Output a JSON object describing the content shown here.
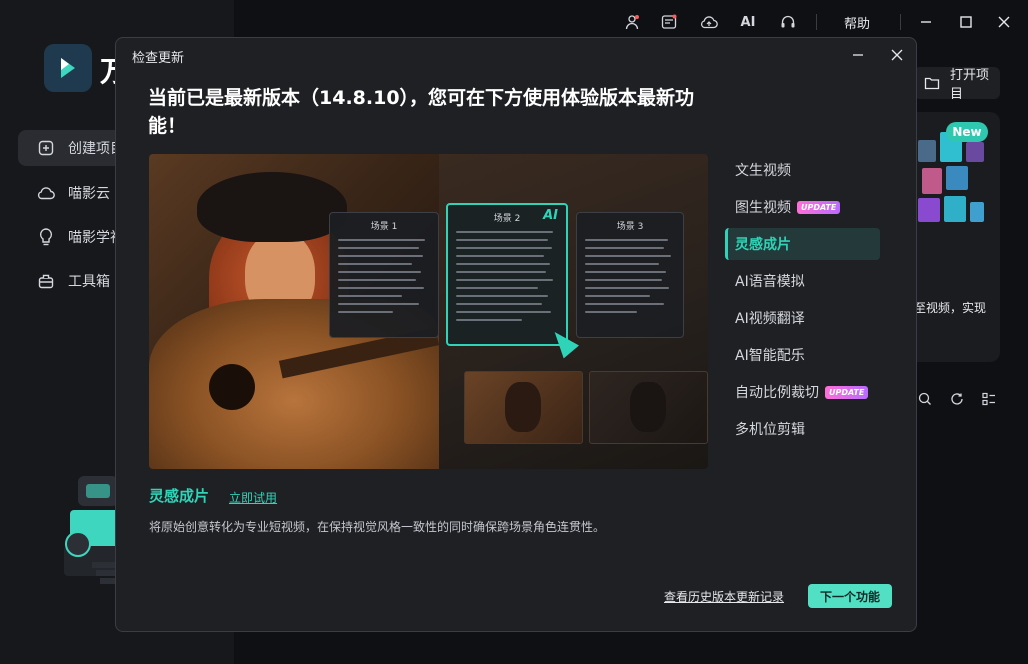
{
  "app": {
    "logo_text": "万",
    "nav": [
      {
        "label": "创建项目"
      },
      {
        "label": "喵影云"
      },
      {
        "label": "喵影学社"
      },
      {
        "label": "工具箱"
      }
    ],
    "help_label": "帮助",
    "open_project_label": "打开项目",
    "promo": {
      "new_badge": "New",
      "text": "至视频，实现"
    }
  },
  "modal": {
    "title": "检查更新",
    "headline": "当前已是最新版本（14.8.10），您可在下方使用体验版本最新功能！",
    "hero": {
      "scenes": [
        {
          "title": "场景 1"
        },
        {
          "title": "场景 2",
          "ai": "AI"
        },
        {
          "title": "场景 3"
        }
      ]
    },
    "features": [
      {
        "label": "文生视频",
        "badge": ""
      },
      {
        "label": "图生视频",
        "badge": "UPDATE"
      },
      {
        "label": "灵感成片",
        "badge": ""
      },
      {
        "label": "AI语音模拟",
        "badge": ""
      },
      {
        "label": "AI视频翻译",
        "badge": ""
      },
      {
        "label": "AI智能配乐",
        "badge": ""
      },
      {
        "label": "自动比例裁切",
        "badge": "UPDATE"
      },
      {
        "label": "多机位剪辑",
        "badge": ""
      }
    ],
    "selected_feature": {
      "name": "灵感成片",
      "try_label": "立即试用",
      "description": "将原始创意转化为专业短视频，在保持视觉风格一致性的同时确保跨场景角色连贯性。"
    },
    "history_link": "查看历史版本更新记录",
    "next_button": "下一个功能"
  },
  "colors": {
    "accent": "#2fd4b8",
    "next_button_bg": "#52e0c4",
    "update_badge": "#d66bff"
  }
}
